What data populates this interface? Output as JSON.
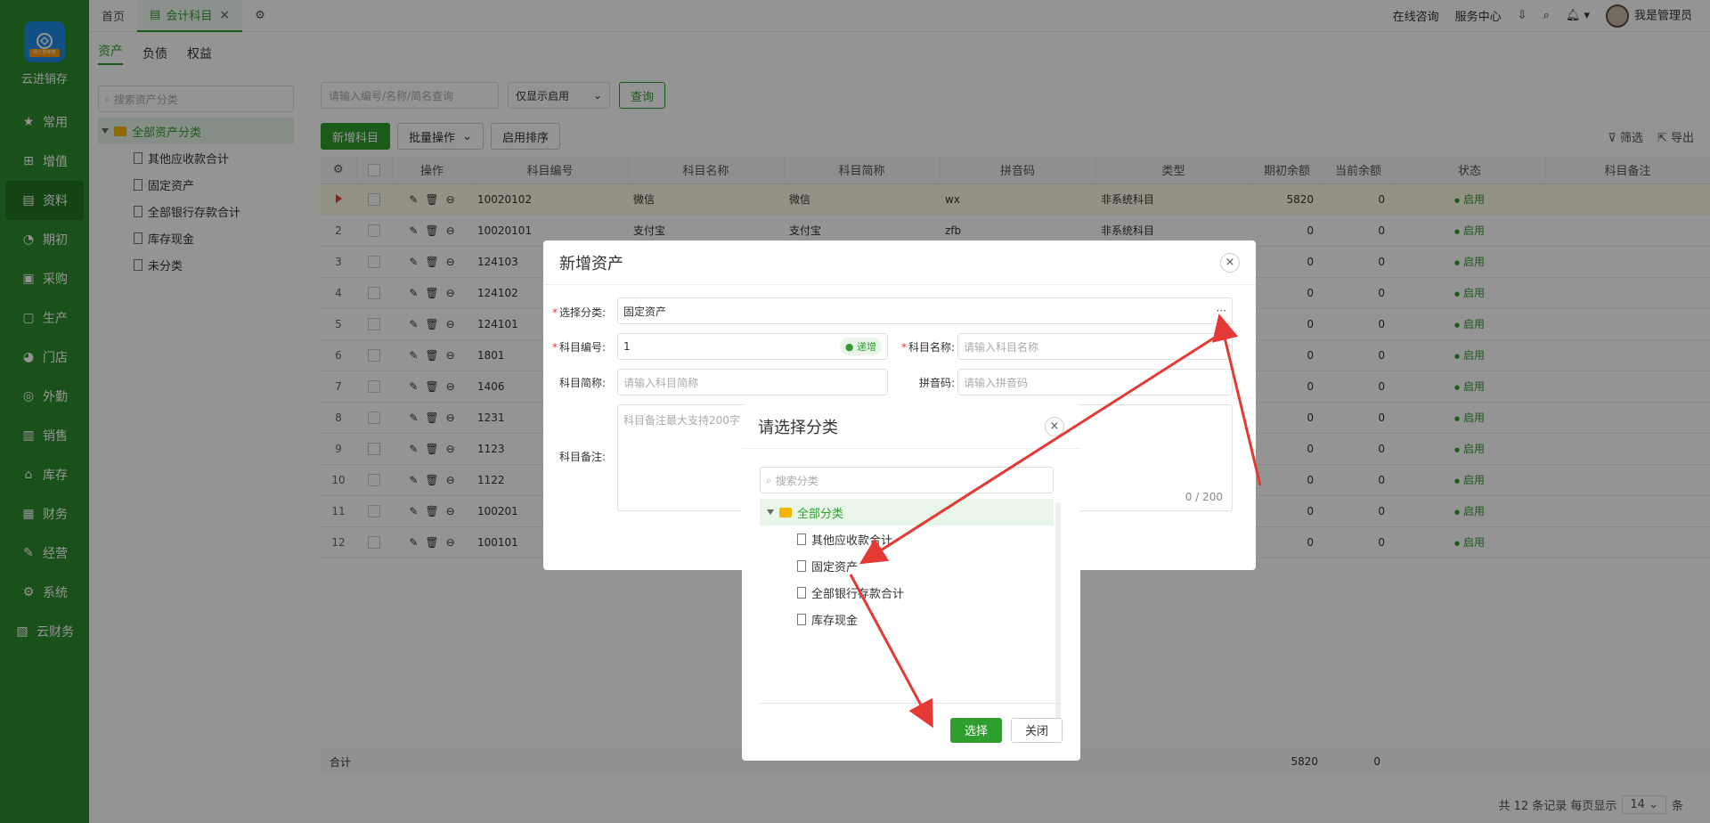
{
  "app": {
    "name": "云进销存",
    "logo_strip": "网上管家婆"
  },
  "sidebar": {
    "items": [
      {
        "label": "常用",
        "icon": "star-icon"
      },
      {
        "label": "增值",
        "icon": "plus-square-icon"
      },
      {
        "label": "资料",
        "icon": "document-icon"
      },
      {
        "label": "期初",
        "icon": "clock-icon"
      },
      {
        "label": "采购",
        "icon": "cart-icon"
      },
      {
        "label": "生产",
        "icon": "factory-icon"
      },
      {
        "label": "门店",
        "icon": "pie-icon"
      },
      {
        "label": "外勤",
        "icon": "location-icon"
      },
      {
        "label": "销售",
        "icon": "bar-chart-icon"
      },
      {
        "label": "库存",
        "icon": "home-icon"
      },
      {
        "label": "财务",
        "icon": "wallet-icon"
      },
      {
        "label": "经营",
        "icon": "edit-icon"
      },
      {
        "label": "系统",
        "icon": "gear-icon"
      },
      {
        "label": "云财务",
        "icon": "cloud-icon"
      }
    ],
    "active_index": 2
  },
  "topbar": {
    "tabs": [
      {
        "label": "首页"
      },
      {
        "label": "会计科目"
      }
    ],
    "online_consult": "在线咨询",
    "service_center": "服务中心",
    "user": "我是管理员"
  },
  "subtabs": [
    "资产",
    "负债",
    "权益"
  ],
  "tree": {
    "search_placeholder": "搜索资产分类",
    "root": "全部资产分类",
    "children": [
      "其他应收款合计",
      "固定资产",
      "全部银行存款合计",
      "库存现金",
      "未分类"
    ]
  },
  "filters": {
    "search_placeholder": "请输入编号/名称/简名查询",
    "status_select": "仅显示启用",
    "query_button": "查询"
  },
  "toolbar": {
    "add_button": "新增科目",
    "batch_button": "批量操作",
    "sort_button": "启用排序",
    "filter_link": "筛选",
    "export_link": "导出"
  },
  "table": {
    "headers": [
      "",
      "",
      "操作",
      "科目编号",
      "科目名称",
      "科目简称",
      "拼音码",
      "类型",
      "期初余额",
      "当前余额",
      "状态",
      "科目备注"
    ],
    "rows": [
      {
        "idx": "",
        "code": "10020102",
        "name": "微信",
        "short": "微信",
        "pinyin": "wx",
        "type": "非系统科目",
        "init": "5820",
        "cur": "0",
        "status": "启用"
      },
      {
        "idx": "2",
        "code": "10020101",
        "name": "支付宝",
        "short": "支付宝",
        "pinyin": "zfb",
        "type": "非系统科目",
        "init": "0",
        "cur": "0",
        "status": "启用"
      },
      {
        "idx": "3",
        "code": "124103",
        "name": "",
        "short": "",
        "pinyin": "",
        "type": "",
        "init": "0",
        "cur": "0",
        "status": "启用"
      },
      {
        "idx": "4",
        "code": "124102",
        "name": "",
        "short": "",
        "pinyin": "",
        "type": "",
        "init": "0",
        "cur": "0",
        "status": "启用"
      },
      {
        "idx": "5",
        "code": "124101",
        "name": "",
        "short": "",
        "pinyin": "",
        "type": "",
        "init": "0",
        "cur": "0",
        "status": "启用"
      },
      {
        "idx": "6",
        "code": "1801",
        "name": "",
        "short": "",
        "pinyin": "",
        "type": "",
        "init": "0",
        "cur": "0",
        "status": "启用"
      },
      {
        "idx": "7",
        "code": "1406",
        "name": "",
        "short": "",
        "pinyin": "",
        "type": "",
        "init": "0",
        "cur": "0",
        "status": "启用"
      },
      {
        "idx": "8",
        "code": "1231",
        "name": "",
        "short": "",
        "pinyin": "",
        "type": "",
        "init": "0",
        "cur": "0",
        "status": "启用"
      },
      {
        "idx": "9",
        "code": "1123",
        "name": "",
        "short": "",
        "pinyin": "",
        "type": "",
        "init": "0",
        "cur": "0",
        "status": "启用"
      },
      {
        "idx": "10",
        "code": "1122",
        "name": "",
        "short": "",
        "pinyin": "",
        "type": "",
        "init": "0",
        "cur": "0",
        "status": "启用"
      },
      {
        "idx": "11",
        "code": "100201",
        "name": "",
        "short": "",
        "pinyin": "",
        "type": "",
        "init": "0",
        "cur": "0",
        "status": "启用"
      },
      {
        "idx": "12",
        "code": "100101",
        "name": "",
        "short": "",
        "pinyin": "",
        "type": "",
        "init": "0",
        "cur": "0",
        "status": "启用"
      }
    ],
    "summary": {
      "label": "合计",
      "init": "5820",
      "cur": "0"
    }
  },
  "pager": {
    "text": "共 12 条记录 每页显示",
    "page_size": "14",
    "unit": "条"
  },
  "add_dialog": {
    "title": "新增资产",
    "category_label": "选择分类:",
    "category_value": "固定资产",
    "code_label": "科目编号:",
    "code_value": "1",
    "increment_badge": "递增",
    "name_label": "科目名称:",
    "name_placeholder": "请输入科目名称",
    "short_label": "科目简称:",
    "short_placeholder": "请输入科目简称",
    "pinyin_label": "拼音码:",
    "pinyin_placeholder": "请输入拼音码",
    "remark_label": "科目备注:",
    "remark_placeholder": "科目备注最大支持200字",
    "remark_counter": "0 / 200"
  },
  "category_dialog": {
    "title": "请选择分类",
    "search_placeholder": "搜索分类",
    "root": "全部分类",
    "children": [
      "其他应收款合计",
      "固定资产",
      "全部银行存款合计",
      "库存现金"
    ],
    "select_button": "选择",
    "close_button": "关闭"
  },
  "colors": {
    "accent": "#2e9e2e",
    "sidebar": "#2e8b2e",
    "annotation": "#e53935"
  }
}
